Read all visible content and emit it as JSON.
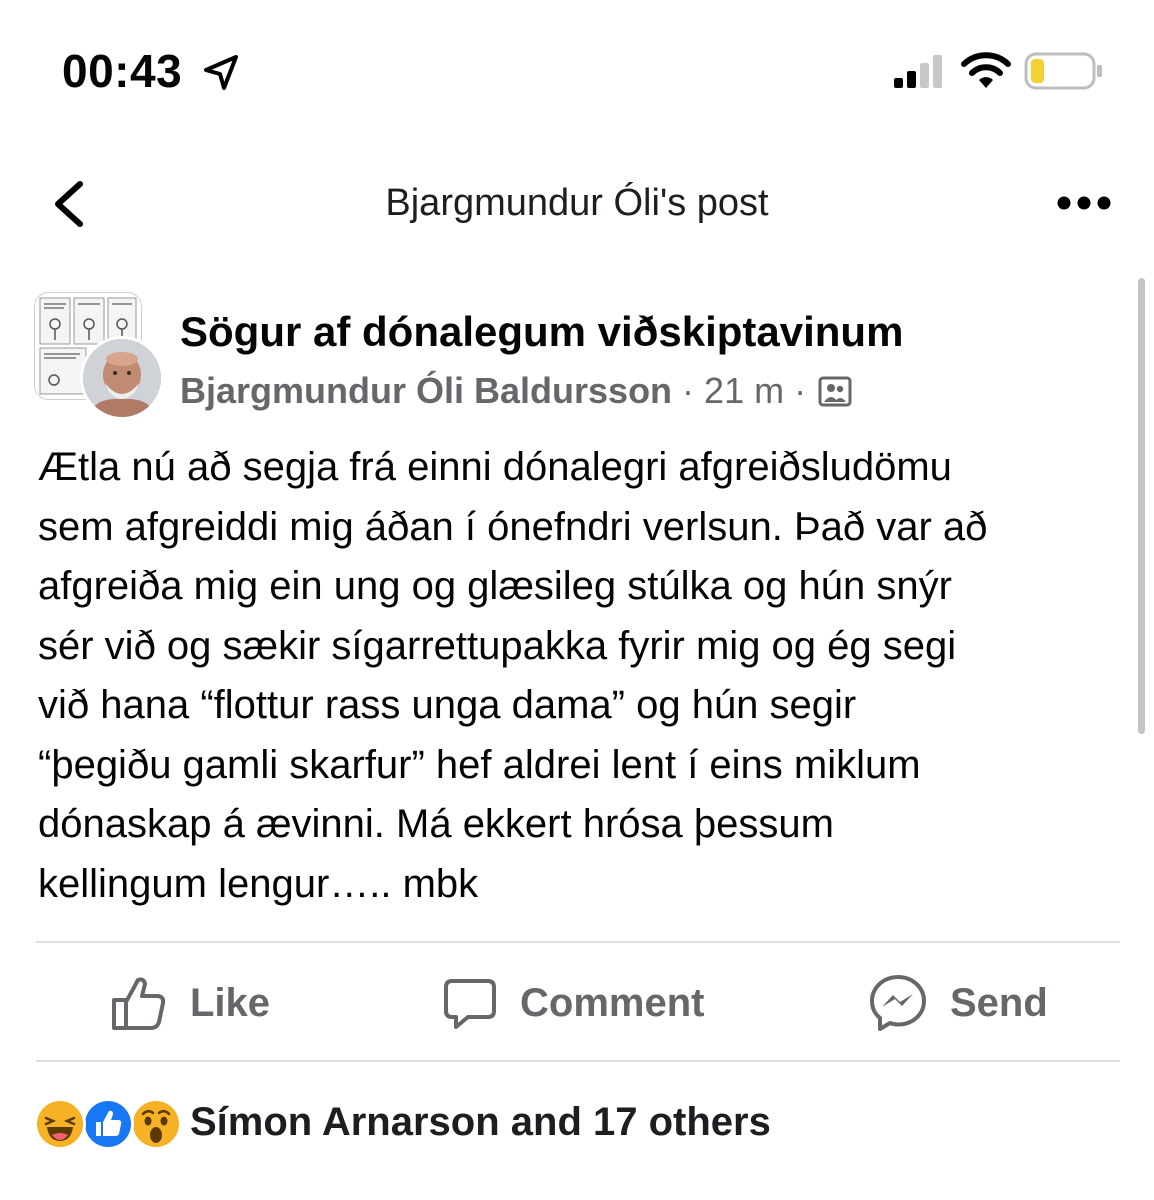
{
  "status_bar": {
    "time": "00:43",
    "icons": [
      "location-arrow-icon",
      "cellular-signal-icon",
      "wifi-icon",
      "battery-low-icon"
    ],
    "battery_color": "#f5d033"
  },
  "header": {
    "title": "Bjargmundur Óli's post",
    "back_icon": "chevron-left-icon",
    "more_icon": "ellipsis-icon"
  },
  "post": {
    "group_name": "Sögur af dónalegum viðskiptavinum",
    "author": "Bjargmundur Óli Baldursson",
    "separator": "·",
    "time": "21 m",
    "audience_icon": "group-members-icon",
    "text": "Ætla nú að segja frá einni dónalegri afgreiðsludömu\nsem afgreiddi mig áðan í ónefndri verlsun. Það var að\nafgreiða mig ein ung og glæsileg stúlka og hún snýr\nsér við og sækir sígarrettupakka fyrir mig og ég segi\nvið hana “flottur rass unga dama” og hún segir\n“þegiðu gamli skarfur” hef aldrei lent í eins miklum\ndónaskap á ævinni. Má ekkert hrósa þessum\nkellingum lengur….. mbk"
  },
  "actions": {
    "like": "Like",
    "comment": "Comment",
    "send": "Send"
  },
  "reactions": {
    "icons": [
      "haha-reaction-icon",
      "like-reaction-icon",
      "wow-reaction-icon"
    ],
    "summary": "Símon Arnarson and 17 others"
  },
  "colors": {
    "secondary_text": "#65676b",
    "primary_text": "#050505",
    "divider": "#dddfe2",
    "like_blue": "#1877f2",
    "reaction_yellow": "#f7b125"
  }
}
